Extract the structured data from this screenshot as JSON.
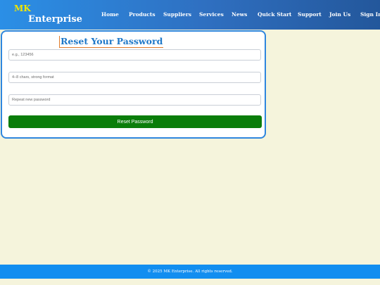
{
  "header": {
    "brand_line1": "MK",
    "brand_line2": "Enterprise",
    "nav": [
      "Home",
      "Products",
      "Suppliers",
      "Services",
      "News",
      "Quick Start",
      "Support",
      "Join Us",
      "Sign In"
    ]
  },
  "form": {
    "title": "Reset Your Password",
    "code_placeholder": "e.g., 123456",
    "new_password_placeholder": "4–8 chars, strong format",
    "confirm_password_placeholder": "Repeat new password",
    "submit_label": "Reset Password"
  },
  "footer": {
    "text": "© 2025 MK Enterprise. All rights reserved."
  },
  "colors": {
    "header_gradient_start": "#2b8fe6",
    "header_gradient_end": "#23579b",
    "brand_accent": "#f3e600",
    "title_color": "#1f78c8",
    "button_green": "#0a7d0a",
    "footer_blue": "#128ef0",
    "page_background": "#f5f4dc"
  }
}
